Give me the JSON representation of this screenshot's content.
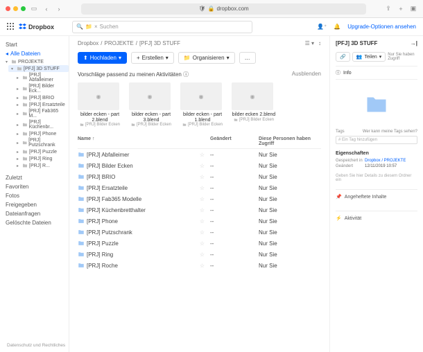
{
  "browser": {
    "url": "dropbox.com"
  },
  "brand": "Dropbox",
  "search_placeholder": "Suchen",
  "upgrade_link": "Upgrade-Optionen ansehen",
  "sidebar": {
    "start": "Start",
    "all_files": "Alle Dateien",
    "recent": "Zuletzt",
    "favorites": "Favoriten",
    "photos": "Fotos",
    "shared": "Freigegeben",
    "requests": "Dateianfragen",
    "deleted": "Gelöschte Dateien",
    "tree_root": "PROJEKTE",
    "selected": "[PFJ] 3D STUFF",
    "children": [
      "[PRJ] Abfalleimer",
      "[PRJ] Bilder Eck...",
      "[PRJ] BRIO",
      "[PRJ] Ersatzteile",
      "[PRJ] Fab365 M...",
      "[PRJ] Küchenbr...",
      "[PRJ] Phone",
      "[PRJ] Putzschrank",
      "[PRJ] Puzzle",
      "[PRJ] Ring",
      "[PRJ] R..."
    ]
  },
  "breadcrumbs": [
    "Dropbox",
    "PROJEKTE",
    "[PFJ] 3D STUFF"
  ],
  "toolbar": {
    "upload": "Hochladen",
    "create": "Erstellen",
    "organize": "Organisieren"
  },
  "suggestions_title": "Vorschläge passend zu meinen Aktivitäten",
  "suggestions_hide": "Ausblenden",
  "suggestions": [
    {
      "name": "bilder ecken - part 2.blend",
      "loc": "[PRJ] Bilder Ecken"
    },
    {
      "name": "bilder ecken - part 3.blend",
      "loc": "[PRJ] Bilder Ecken"
    },
    {
      "name": "bilder ecken - part 1.blend",
      "loc": "[PRJ] Bilder Ecken"
    },
    {
      "name": "bilder ecken 2.blend",
      "loc": "[PRJ] Bilder Ecken"
    }
  ],
  "columns": {
    "name": "Name",
    "modified": "Geändert",
    "access": "Diese Personen haben Zugriff"
  },
  "rows": [
    {
      "name": "[PRJ] Abfalleimer",
      "mod": "--",
      "acc": "Nur Sie"
    },
    {
      "name": "[PRJ] Bilder Ecken",
      "mod": "--",
      "acc": "Nur Sie"
    },
    {
      "name": "[PRJ] BRIO",
      "mod": "--",
      "acc": "Nur Sie"
    },
    {
      "name": "[PRJ] Ersatzteile",
      "mod": "--",
      "acc": "Nur Sie"
    },
    {
      "name": "[PRJ] Fab365 Modelle",
      "mod": "--",
      "acc": "Nur Sie"
    },
    {
      "name": "[PRJ] Küchenbretthalter",
      "mod": "--",
      "acc": "Nur Sie"
    },
    {
      "name": "[PRJ] Phone",
      "mod": "--",
      "acc": "Nur Sie"
    },
    {
      "name": "[PRJ] Putzschrank",
      "mod": "--",
      "acc": "Nur Sie"
    },
    {
      "name": "[PRJ] Puzzle",
      "mod": "--",
      "acc": "Nur Sie"
    },
    {
      "name": "[PRJ] Ring",
      "mod": "--",
      "acc": "Nur Sie"
    },
    {
      "name": "[PRJ] Roche",
      "mod": "--",
      "acc": "Nur Sie"
    }
  ],
  "detail": {
    "title": "[PFJ] 3D STUFF",
    "share": "Teilen",
    "access_note": "Nur Sie haben Zugriff",
    "info": "Info",
    "tags": "Tags",
    "tags_help": "Wer kann meine Tags sehen?",
    "tags_placeholder": "# Ein Tag hinzufügen",
    "properties": "Eigenschaften",
    "saved_in": "Gespeichert in",
    "saved_in_val": "Dropbox / PROJEKTE",
    "modified": "Geändert",
    "modified_val": "12/11/2019 10:57",
    "footer": "Geben Sie hier Details zu diesem Ordner ein",
    "pinned": "Angeheftete Inhalte",
    "activity": "Aktivität"
  },
  "legal": "Datenschutz und Rechtliches"
}
